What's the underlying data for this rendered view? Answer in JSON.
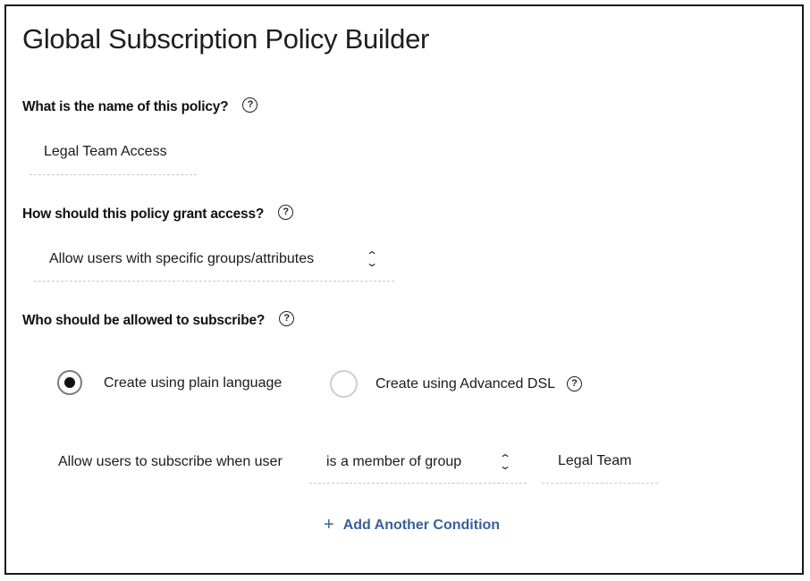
{
  "header": {
    "title": "Global Subscription Policy Builder"
  },
  "policy_name": {
    "question": "What is the name of this policy?",
    "help_icon": "question-circle-icon",
    "value": "Legal Team Access"
  },
  "grant_access": {
    "question": "How should this policy grant access?",
    "help_icon": "question-circle-icon",
    "selected": "Allow users with specific groups/attributes",
    "select_icon": "chevron-up-down-icon"
  },
  "subscribe": {
    "question": "Who should be allowed to subscribe?",
    "help_icon": "question-circle-icon",
    "modes": [
      {
        "label": "Create using plain language",
        "selected": true
      },
      {
        "label": "Create using Advanced DSL",
        "selected": false,
        "help_icon": "question-circle-icon"
      }
    ]
  },
  "condition": {
    "prefix": "Allow users to subscribe when user",
    "operator": "is a member of group",
    "operator_icon": "chevron-up-down-icon",
    "value": "Legal Team"
  },
  "add_condition": {
    "icon": "plus-icon",
    "label": "Add Another Condition",
    "color": "#3a5f9a"
  },
  "glyphs": {
    "help": "?",
    "plus": "+",
    "chev_up": "⌃",
    "chev_down": "⌄"
  }
}
